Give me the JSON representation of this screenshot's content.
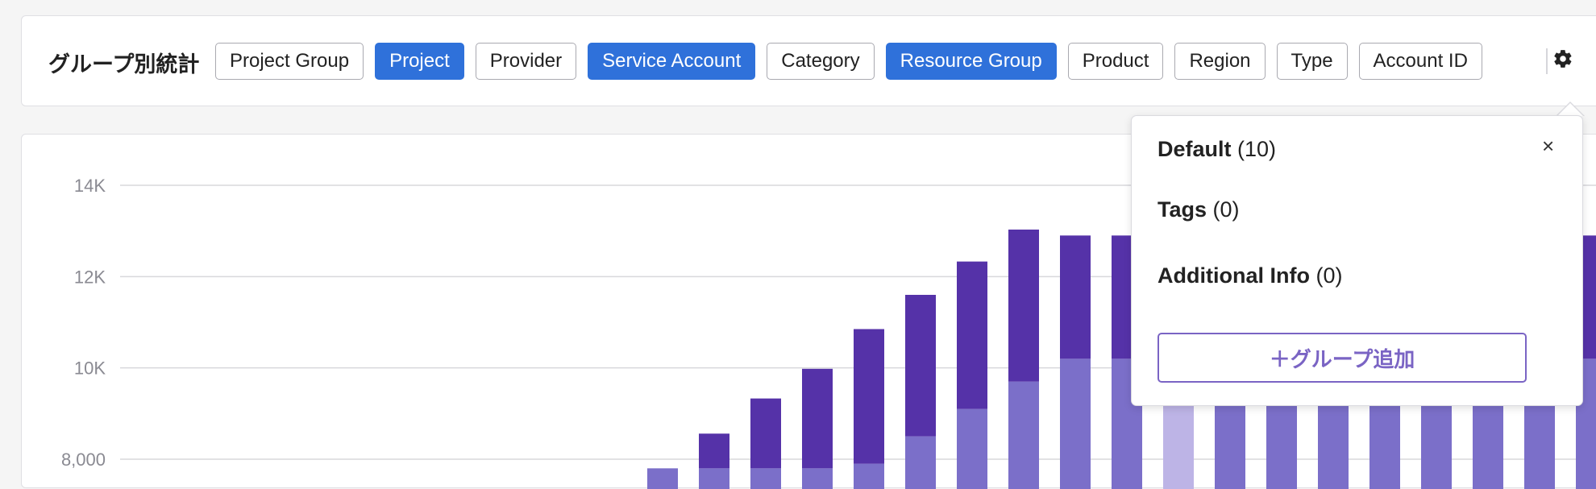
{
  "toolbar": {
    "title": "グループ別統計",
    "chips": [
      {
        "label": "Project Group",
        "selected": false
      },
      {
        "label": "Project",
        "selected": true
      },
      {
        "label": "Provider",
        "selected": false
      },
      {
        "label": "Service Account",
        "selected": true
      },
      {
        "label": "Category",
        "selected": false
      },
      {
        "label": "Resource Group",
        "selected": true
      },
      {
        "label": "Product",
        "selected": false
      },
      {
        "label": "Region",
        "selected": false
      },
      {
        "label": "Type",
        "selected": false
      },
      {
        "label": "Account ID",
        "selected": false
      }
    ],
    "settings_icon": "gear-icon",
    "accent_color": "#2f71da"
  },
  "popover": {
    "items": [
      {
        "label": "Default",
        "count": "(10)"
      },
      {
        "label": "Tags",
        "count": "(0)"
      },
      {
        "label": "Additional Info",
        "count": "(0)"
      }
    ],
    "close_icon": "close-icon",
    "close_glyph": "×",
    "add_button_label": "＋グループ追加",
    "accent_color": "#7a64c4"
  },
  "chart_data": {
    "type": "bar",
    "stacked": true,
    "yticks": [
      "8,000",
      "10K",
      "12K",
      "14K"
    ],
    "ytick_values": [
      8000,
      10000,
      12000,
      14000
    ],
    "ylim_visible": [
      7750,
      14600
    ],
    "grid": true,
    "colors": {
      "top": "#5532a8",
      "bottom": "#7b6fc9",
      "highlight_top": "#a898d3",
      "highlight_bottom": "#bdb4e6"
    },
    "series": [
      {
        "name": "",
        "values": [
          7800,
          7800,
          7800,
          7800,
          7900,
          8500,
          9100,
          9700,
          10200,
          10200,
          10200,
          10200,
          10200,
          10200,
          10200,
          10200,
          10200,
          10200,
          10200
        ]
      },
      {
        "name": "",
        "values": [
          0,
          760,
          1530,
          2180,
          2950,
          3100,
          3230,
          3330,
          2700,
          2700,
          2700,
          2700,
          2700,
          2700,
          2700,
          2700,
          2700,
          2700,
          2700
        ]
      }
    ],
    "highlight_index": 10,
    "hidden_top_index_start": 11,
    "hidden_top_last_visible": 18
  }
}
